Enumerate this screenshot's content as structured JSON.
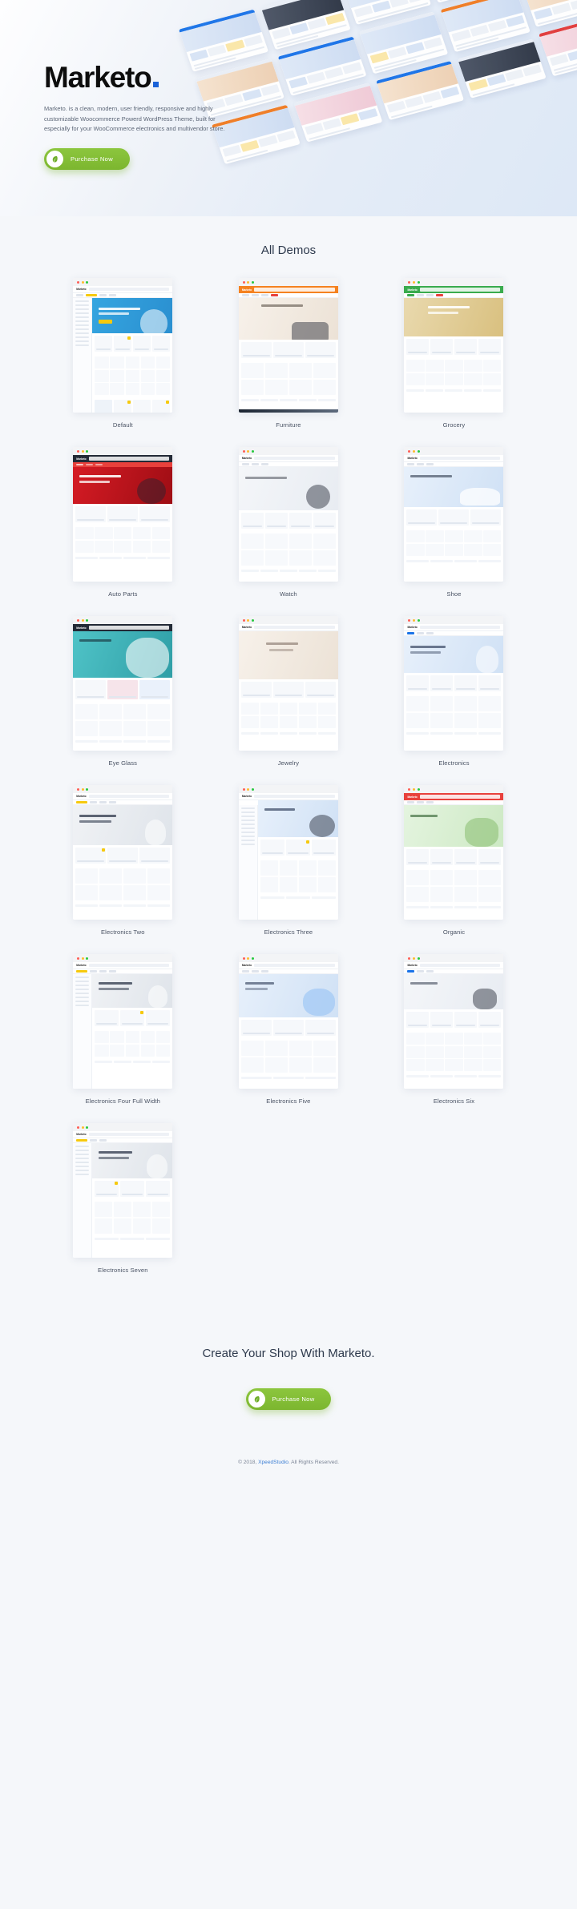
{
  "hero": {
    "title": "Marketo",
    "title_dot": ".",
    "description": "Marketo. is a clean, modern, user friendly, responsive and highly customizable Woocommerce Powerd WordPress Theme, built for especially for your WooCommerce electronics and multivendor store.",
    "cta_label": "Purchase Now",
    "leaf_icon": "leaf-icon",
    "accent_dot_color": "#1a62d8",
    "button_color": "#7cb62f"
  },
  "demos": {
    "section_title": "All Demos",
    "rows": [
      [
        {
          "label": "Default",
          "theme": "default"
        },
        {
          "label": "Furniture",
          "theme": "furniture"
        },
        {
          "label": "Grocery",
          "theme": "grocery"
        }
      ],
      [
        {
          "label": "Auto Parts",
          "theme": "autoparts"
        },
        {
          "label": "Watch",
          "theme": "watch"
        },
        {
          "label": "Shoe",
          "theme": "shoe"
        }
      ],
      [
        {
          "label": "Eye Glass",
          "theme": "eyeglass"
        },
        {
          "label": "Jewelry",
          "theme": "jewelry"
        },
        {
          "label": "Electronics",
          "theme": "electronics"
        }
      ],
      [
        {
          "label": "Electronics Two",
          "theme": "electronics2"
        },
        {
          "label": "Electronics Three",
          "theme": "electronics3"
        },
        {
          "label": "Organic",
          "theme": "organic"
        }
      ],
      [
        {
          "label": "Electronics Four Full Width",
          "theme": "electronics4"
        },
        {
          "label": "Electronics Five",
          "theme": "electronics5"
        },
        {
          "label": "Electronics Six",
          "theme": "electronics6"
        }
      ],
      [
        {
          "label": "Electronics Seven",
          "theme": "electronics7"
        }
      ]
    ],
    "window_dots": [
      "#ff5f57",
      "#febc2e",
      "#28c840"
    ]
  },
  "cta": {
    "title": "Create Your Shop With Marketo.",
    "button_label": "Purchase Now",
    "leaf_icon": "leaf-icon"
  },
  "footer": {
    "copyright_prefix": "© 2018, ",
    "brand": "XpeedStudio",
    "copyright_suffix": ". All Rights Reserved."
  }
}
